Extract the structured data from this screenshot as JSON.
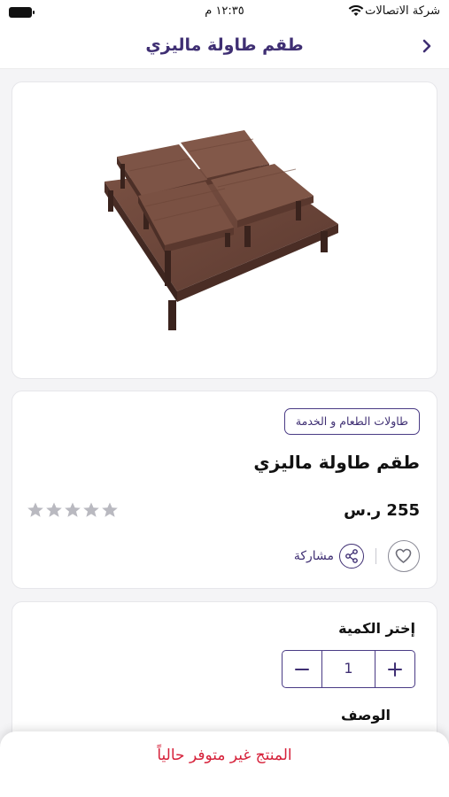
{
  "status_bar": {
    "carrier": "شركة الاتصالات",
    "time": "١٢:٣٥ م"
  },
  "nav": {
    "title": "طقم طاولة ماليزي",
    "back_icon": "chevron-right-icon"
  },
  "product": {
    "category": "طاولات الطعام و الخدمة",
    "name": "طقم طاولة ماليزي",
    "price": "255 ر.س",
    "rating": 0,
    "rating_max": 5,
    "share_label": "مشاركة"
  },
  "quantity": {
    "label": "إختر الكمية",
    "value": "1"
  },
  "description": {
    "label": "الوصف"
  },
  "footer": {
    "unavailable_text": "المنتج غير متوفر حالياً"
  },
  "colors": {
    "primary": "#3f2f73",
    "alert": "#d6213a",
    "star_empty": "#b9b9c0"
  }
}
